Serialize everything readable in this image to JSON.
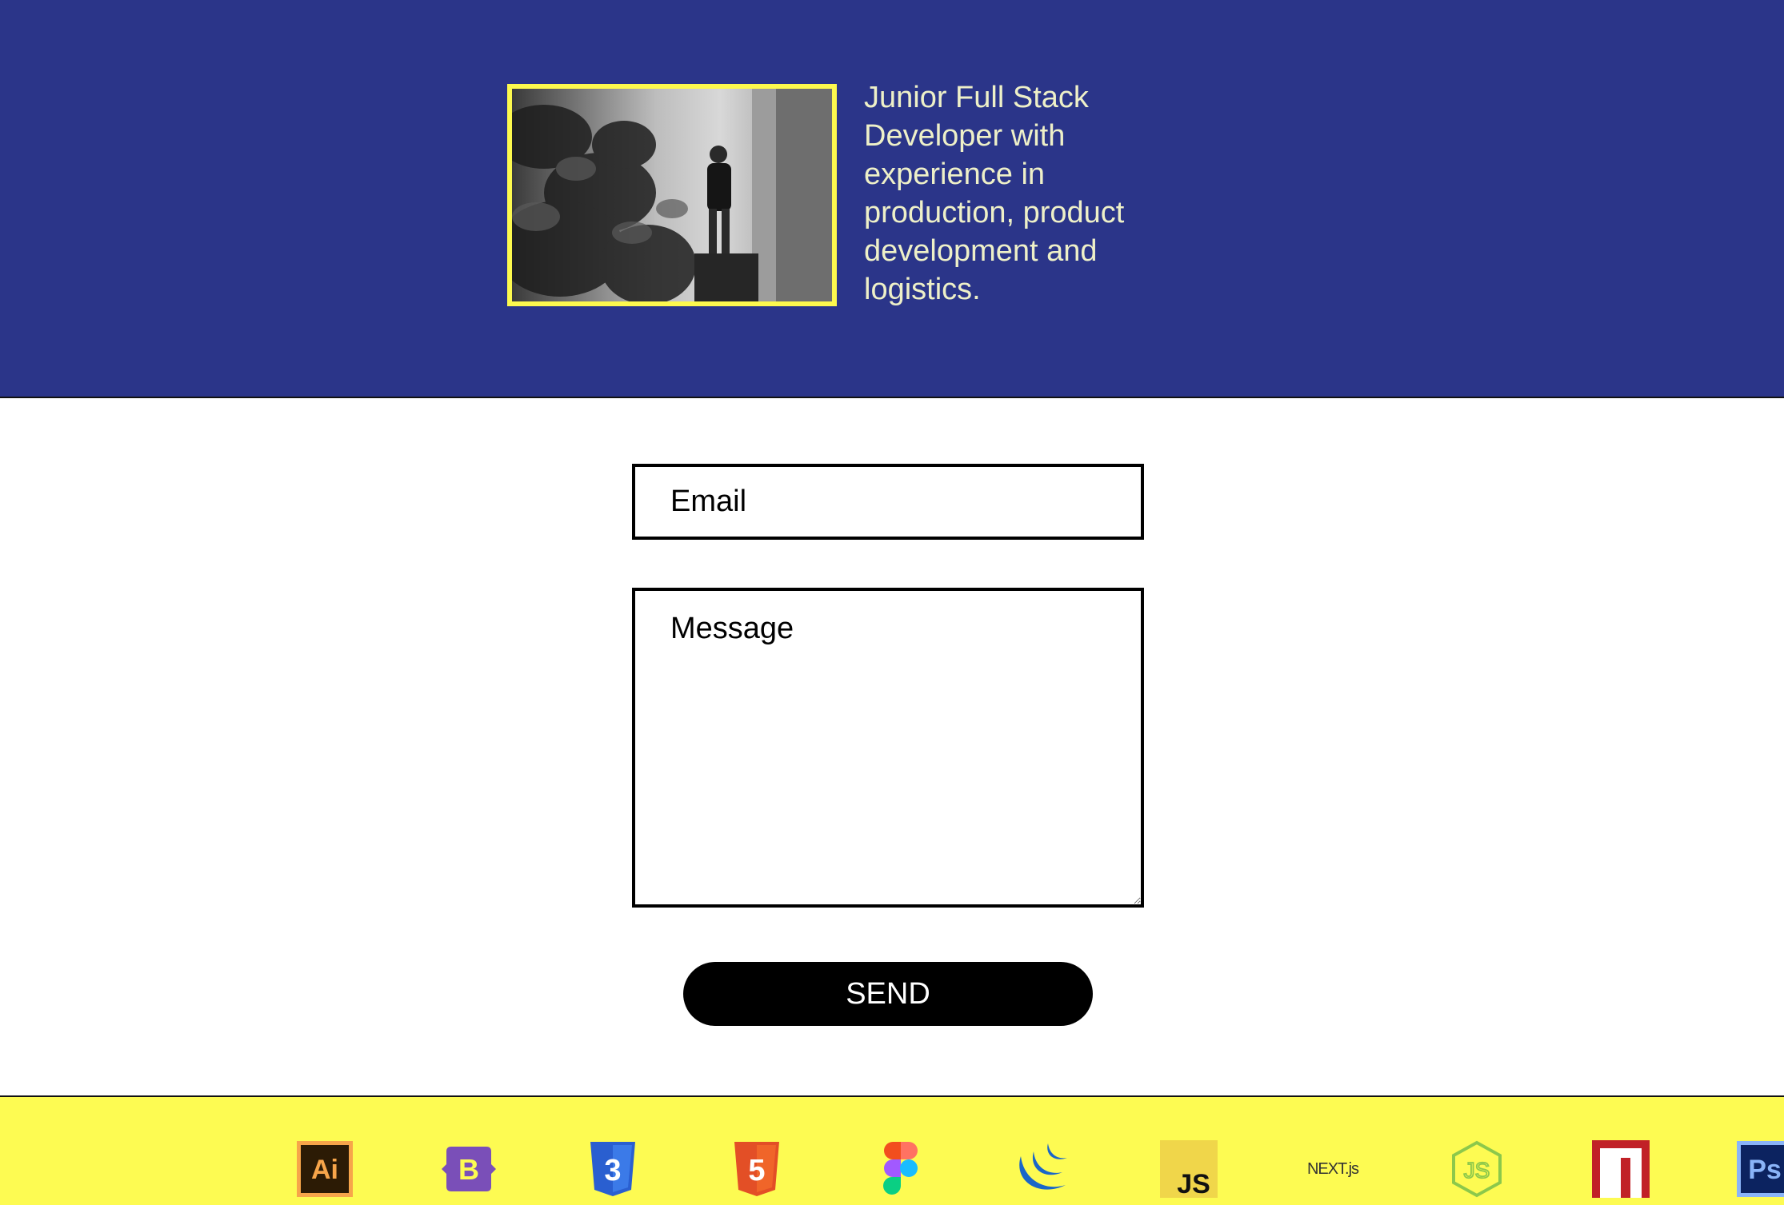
{
  "hero": {
    "photo_alt": "profile-photo",
    "intro_text": "Junior Full Stack Developer with experience in production, product development and logistics."
  },
  "contact_form": {
    "email_placeholder": "Email",
    "message_placeholder": "Message",
    "send_label": "SEND"
  },
  "tech_icons": [
    {
      "name": "illustrator-icon",
      "label": "Ai"
    },
    {
      "name": "bootstrap-icon",
      "label": "B"
    },
    {
      "name": "css3-icon",
      "label": "3"
    },
    {
      "name": "html5-icon",
      "label": "5"
    },
    {
      "name": "figma-icon",
      "label": ""
    },
    {
      "name": "jquery-icon",
      "label": ""
    },
    {
      "name": "javascript-icon",
      "label": "JS"
    },
    {
      "name": "nextjs-icon",
      "label": "NEXT.js"
    },
    {
      "name": "nodejs-icon",
      "label": "JS"
    },
    {
      "name": "npm-icon",
      "label": ""
    },
    {
      "name": "photoshop-icon",
      "label": "Ps"
    }
  ],
  "colors": {
    "hero_bg": "#2b3589",
    "photo_border": "#fdf94e",
    "intro_text": "#eef0c8",
    "footer_bg": "#fdfb52",
    "button_bg": "#000000"
  }
}
